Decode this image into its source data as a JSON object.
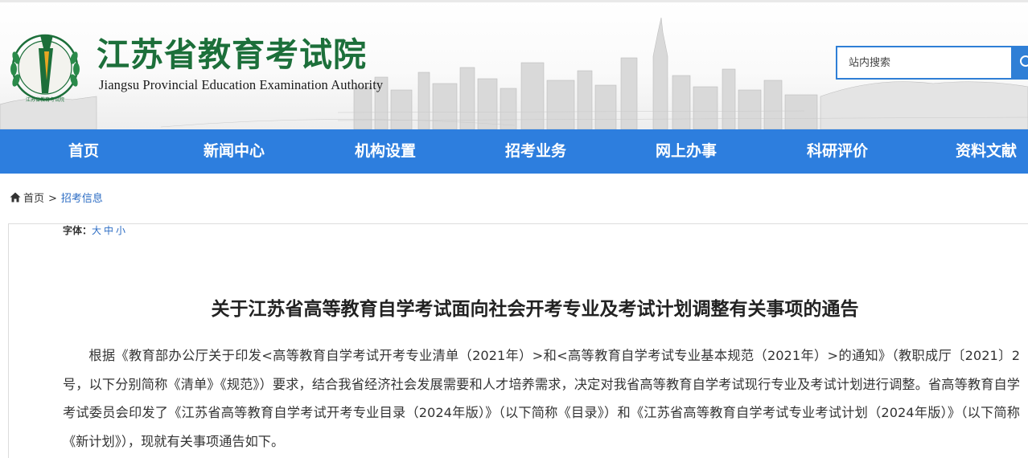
{
  "header": {
    "logo_cn": "江苏省教育考试院",
    "logo_en": "Jiangsu Provincial Education Examination Authority",
    "emblem_text": "江苏省教育考试院"
  },
  "search": {
    "placeholder": "站内搜索"
  },
  "nav": {
    "items": [
      {
        "label": "首页"
      },
      {
        "label": "新闻中心"
      },
      {
        "label": "机构设置"
      },
      {
        "label": "招考业务"
      },
      {
        "label": "网上办事"
      },
      {
        "label": "科研评价"
      },
      {
        "label": "资料文献"
      }
    ]
  },
  "breadcrumb": {
    "home": "首页",
    "separator": ">",
    "current": "招考信息"
  },
  "font_size": {
    "label": "字体：",
    "large": "大",
    "medium": "中",
    "small": "小"
  },
  "article": {
    "title": "关于江苏省高等教育自学考试面向社会开考专业及考试计划调整有关事项的通告",
    "body": "根据《教育部办公厅关于印发<高等教育自学考试开考专业清单（2021年）>和<高等教育自学考试专业基本规范（2021年）>的通知》（教职成厅〔2021〕2号，以下分别简称《清单》《规范》）要求，结合我省经济社会发展需要和人才培养需求，决定对我省高等教育自学考试现行专业及考试计划进行调整。省高等教育自学考试委员会印发了《江苏省高等教育自学考试开考专业目录（2024年版）》（以下简称《目录》）和《江苏省高等教育自学考试专业考试计划（2024年版）》（以下简称《新计划》），现就有关事项通告如下。"
  },
  "colors": {
    "nav_bg": "#2d7ede",
    "logo_green": "#1c6f3a",
    "link_blue": "#2d6dc4"
  }
}
